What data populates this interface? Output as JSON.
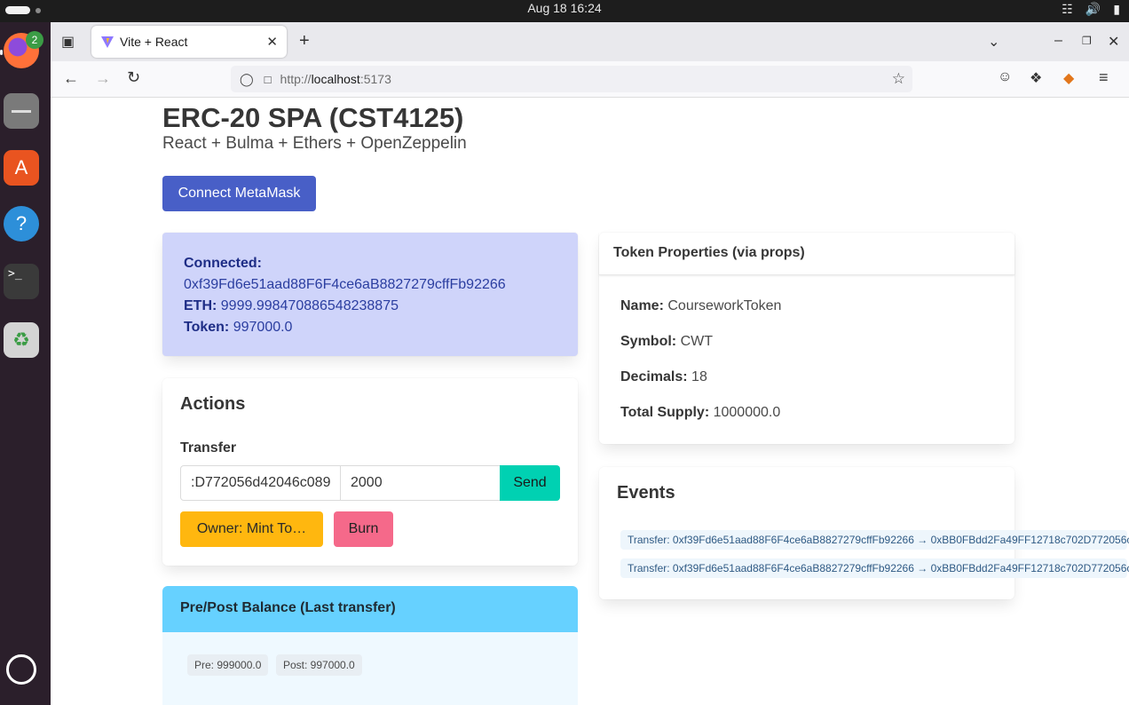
{
  "system": {
    "clock": "Aug 18  16:24",
    "tray_icons": [
      "network-icon",
      "volume-icon",
      "battery-icon"
    ]
  },
  "dock": {
    "items": [
      {
        "name": "firefox-icon",
        "badge": "2"
      },
      {
        "name": "files-icon"
      },
      {
        "name": "app-center-icon"
      },
      {
        "name": "help-icon"
      },
      {
        "name": "terminal-icon"
      },
      {
        "name": "trash-icon"
      },
      {
        "name": "ubuntu-icon"
      }
    ]
  },
  "browser": {
    "tab_title": "Vite + React",
    "url_proto": "http://",
    "url_host": "localhost",
    "url_port": ":5173"
  },
  "page": {
    "title": "ERC-20 SPA (CST4125)",
    "subtitle": "React + Bulma + Ethers + OpenZeppelin",
    "connect_label": "Connect MetaMask",
    "connection": {
      "connected_label": "Connected:",
      "address": "0xf39Fd6e51aad88F6F4ce6aB8827279cffFb92266",
      "eth_label": "ETH:",
      "eth_value": "9999.998470886548238875",
      "token_label": "Token:",
      "token_value": "997000.0"
    },
    "actions": {
      "title": "Actions",
      "transfer_label": "Transfer",
      "recipient_value": ":D772056d42046c089",
      "amount_value": "2000",
      "send_label": "Send",
      "mint_label": "Owner: Mint To…",
      "burn_label": "Burn"
    },
    "prepost": {
      "title": "Pre/Post Balance (Last transfer)",
      "pre": "Pre: 999000.0",
      "post": "Post: 997000.0"
    },
    "props": {
      "title": "Token Properties (via props)",
      "name_label": "Name:",
      "name_value": "CourseworkToken",
      "symbol_label": "Symbol:",
      "symbol_value": "CWT",
      "decimals_label": "Decimals:",
      "decimals_value": "18",
      "supply_label": "Total Supply:",
      "supply_value": "1000000.0"
    },
    "events": {
      "title": "Events",
      "items": [
        "Transfer: 0xf39Fd6e51aad88F6F4ce6aB8827279cffFb92266 → 0xBB0FBdd2Fa49FF12718c702D772056c",
        "Transfer: 0xf39Fd6e51aad88F6F4ce6aB8827279cffFb92266 → 0xBB0FBdd2Fa49FF12718c702D772056c"
      ]
    }
  }
}
